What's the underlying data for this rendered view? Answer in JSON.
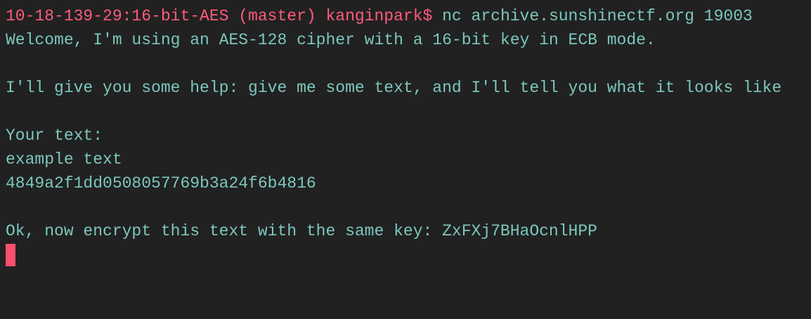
{
  "terminal": {
    "prompt": "10-18-139-29:16-bit-AES (master) kanginpark$",
    "command": "nc archive.sunshinectf.org 19003",
    "output": [
      "Welcome, I'm using an AES-128 cipher with a 16-bit key in ECB mode.",
      "",
      "I'll give you some help: give me some text, and I'll tell you what it looks like",
      "",
      "Your text:",
      "example text",
      "4849a2f1dd0508057769b3a24f6b4816",
      "",
      "Ok, now encrypt this text with the same key: ZxFXj7BHaOcnlHPP"
    ]
  },
  "colors": {
    "background": "#212121",
    "prompt": "#ff5c7c",
    "text": "#7cc7bd",
    "cursor": "#ff4f6d"
  }
}
